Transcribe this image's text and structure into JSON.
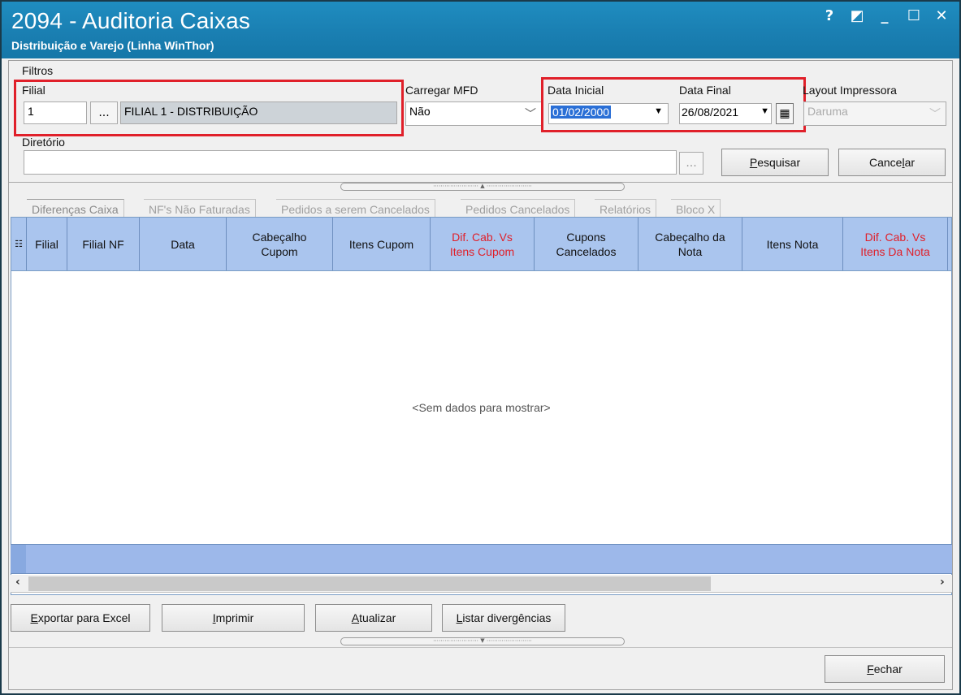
{
  "window": {
    "title": "2094 - Auditoria Caixas",
    "subtitle": "Distribuição e Varejo (Linha WinThor)",
    "controls": [
      "?",
      "◩",
      "_",
      "☐",
      "✕"
    ]
  },
  "filters": {
    "group_label": "Filtros",
    "filial_label": "Filial",
    "filial_code": "1",
    "filial_lookup": "...",
    "filial_name": "FILIAL 1 - DISTRIBUIÇÃO",
    "carregar_mfd_label": "Carregar MFD",
    "carregar_mfd_value": "Não",
    "data_inicial_label": "Data Inicial",
    "data_inicial_value": "01/02/2000",
    "data_final_label": "Data Final",
    "data_final_value": "26/08/2021",
    "layout_impressora_label": "Layout Impressora",
    "layout_impressora_value": "Daruma",
    "diretorio_label": "Diretório",
    "diretorio_lookup": "...",
    "pesquisar_label_u": "P",
    "pesquisar_label_rest": "esquisar",
    "cancelar_label_a": "Cance",
    "cancelar_label_u": "l",
    "cancelar_label_b": "ar"
  },
  "tabs": [
    "Diferenças Caixa",
    "NF's Não Faturadas",
    "Pedidos a serem Cancelados",
    "Pedidos Cancelados",
    "Relatórios",
    "Bloco X"
  ],
  "grid": {
    "columns": [
      {
        "label": "Filial",
        "red": false
      },
      {
        "label": "Filial NF",
        "red": false
      },
      {
        "label": "Data",
        "red": false
      },
      {
        "label": "Cabeçalho\nCupom",
        "red": false
      },
      {
        "label": "Itens Cupom",
        "red": false
      },
      {
        "label": "Dif. Cab. Vs\nItens Cupom",
        "red": true
      },
      {
        "label": "Cupons\nCancelados",
        "red": false
      },
      {
        "label": "Cabeçalho da\nNota",
        "red": false
      },
      {
        "label": "Itens Nota",
        "red": false
      },
      {
        "label": "Dif. Cab. Vs\nItens Da Nota",
        "red": true
      }
    ],
    "empty_message": "<Sem dados para mostrar>"
  },
  "actions": {
    "exportar_u": "E",
    "exportar_rest": "xportar para Excel",
    "imprimir_u": "I",
    "imprimir_rest": "mprimir",
    "atualizar_u": "A",
    "atualizar_rest": "tualizar",
    "listar_u": "L",
    "listar_rest": "istar divergências",
    "fechar_u": "F",
    "fechar_rest": "echar"
  },
  "colors": {
    "accent_red": "#e0202a",
    "title_blue": "#1a7fb2",
    "grid_header": "#aac5ee"
  }
}
